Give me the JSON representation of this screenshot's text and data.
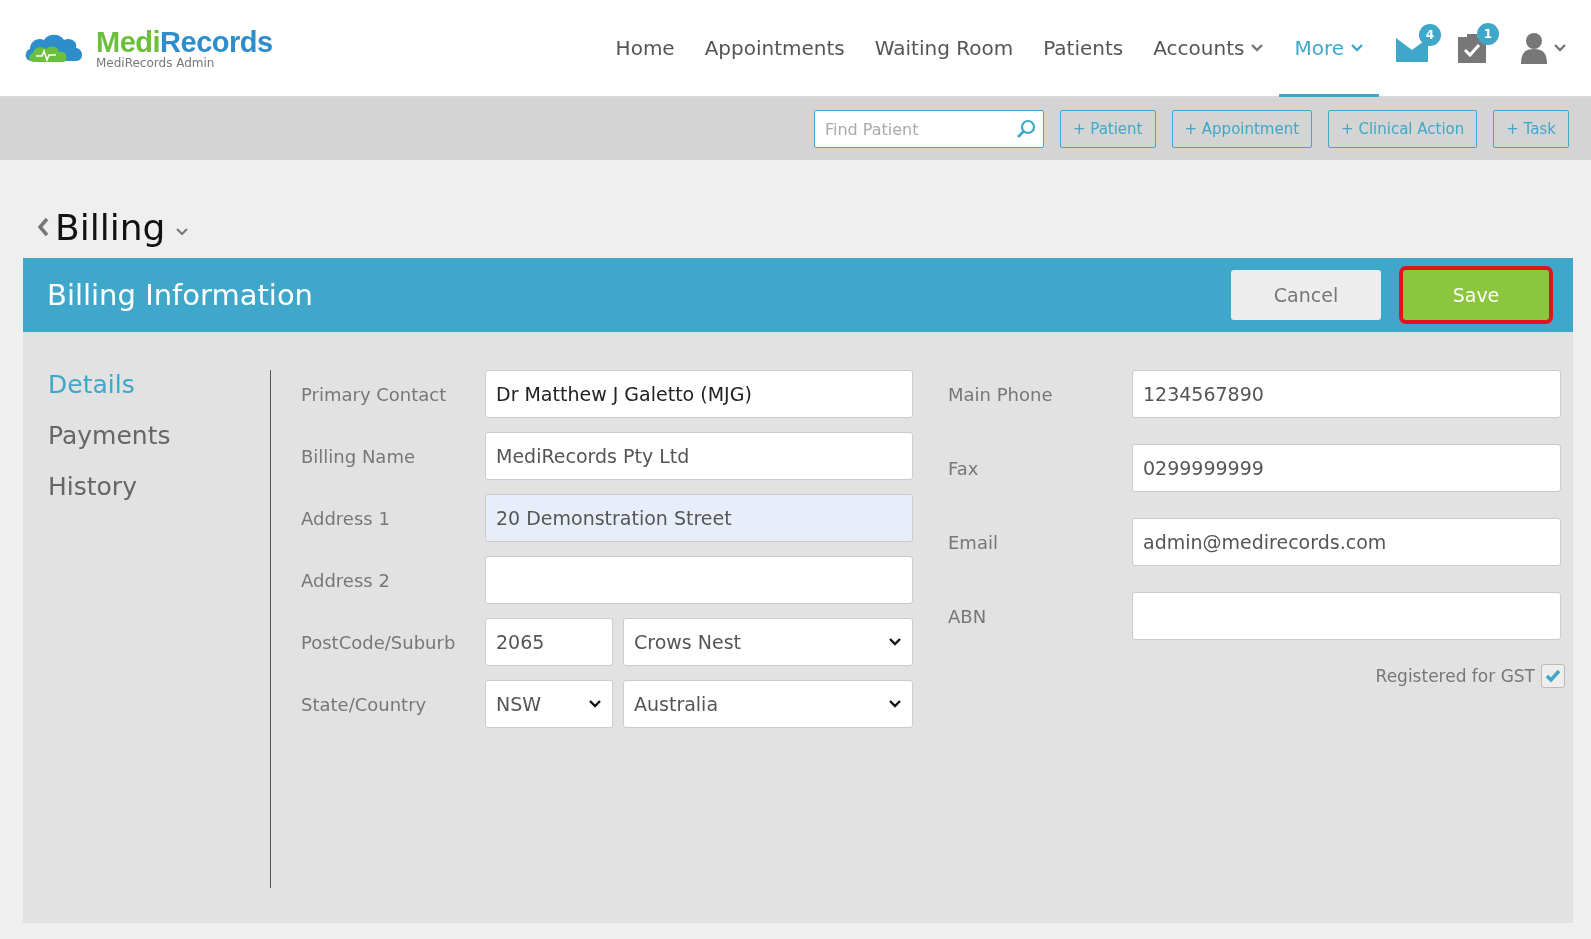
{
  "brand": {
    "name_part_1": "Medi",
    "name_part_2": "Records",
    "subtitle": "MediRecords Admin"
  },
  "nav": [
    {
      "label": "Home",
      "selected": false,
      "dropdown": false
    },
    {
      "label": "Appointments",
      "selected": false,
      "dropdown": false
    },
    {
      "label": "Waiting Room",
      "selected": false,
      "dropdown": false
    },
    {
      "label": "Patients",
      "selected": false,
      "dropdown": false
    },
    {
      "label": "Accounts",
      "selected": false,
      "dropdown": true
    },
    {
      "label": "More",
      "selected": true,
      "dropdown": true
    }
  ],
  "notifications": [
    {
      "kind": "mail",
      "count": "4"
    },
    {
      "kind": "tasks",
      "count": "1"
    }
  ],
  "toolbar": {
    "search": {
      "placeholder": "Find Patient"
    },
    "buttons": [
      "+ Patient",
      "+ Appointment",
      "+ Clinical Action",
      "+ Task"
    ]
  },
  "page_title": "Billing",
  "panel": {
    "title": "Billing Information",
    "buttons": [
      {
        "label": "Cancel",
        "kind": "secondary",
        "highlighted": false
      },
      {
        "label": "Save",
        "kind": "primary",
        "highlighted": true
      }
    ]
  },
  "sidebar": {
    "items": [
      {
        "label": "Details",
        "selected": true
      },
      {
        "label": "Payments",
        "selected": false
      },
      {
        "label": "History",
        "selected": false
      }
    ]
  },
  "left_rows": [
    {
      "label": "Primary Contact",
      "fields": [
        {
          "kind": "text",
          "value": "Dr Matthew J Galetto (MJG)",
          "focused": false
        }
      ]
    },
    {
      "label": "Billing Name",
      "fields": [
        {
          "kind": "text",
          "value": "MediRecords Pty Ltd",
          "focused": false
        }
      ]
    },
    {
      "label": "Address 1",
      "fields": [
        {
          "kind": "text",
          "value": "20 Demonstration Street",
          "focused": true
        }
      ]
    },
    {
      "label": "Address 2",
      "fields": [
        {
          "kind": "text",
          "focused": false
        }
      ]
    },
    {
      "label": "PostCode/Suburb",
      "fields": [
        {
          "kind": "text",
          "value": "2065",
          "focused": false
        },
        {
          "kind": "select",
          "value": "Crows Nest",
          "focused": false
        }
      ]
    },
    {
      "label": "State/Country",
      "fields": [
        {
          "kind": "select",
          "value": "NSW",
          "focused": false
        },
        {
          "kind": "select",
          "value": "Australia",
          "focused": false
        }
      ]
    }
  ],
  "right_rows": [
    {
      "label": "Main Phone",
      "value": "1234567890"
    },
    {
      "label": "Fax",
      "value": "0299999999"
    },
    {
      "label": "Email",
      "value": "admin@medirecords.com"
    },
    {
      "label": "ABN"
    }
  ],
  "gst": {
    "label": "Registered for GST",
    "checked": true
  }
}
